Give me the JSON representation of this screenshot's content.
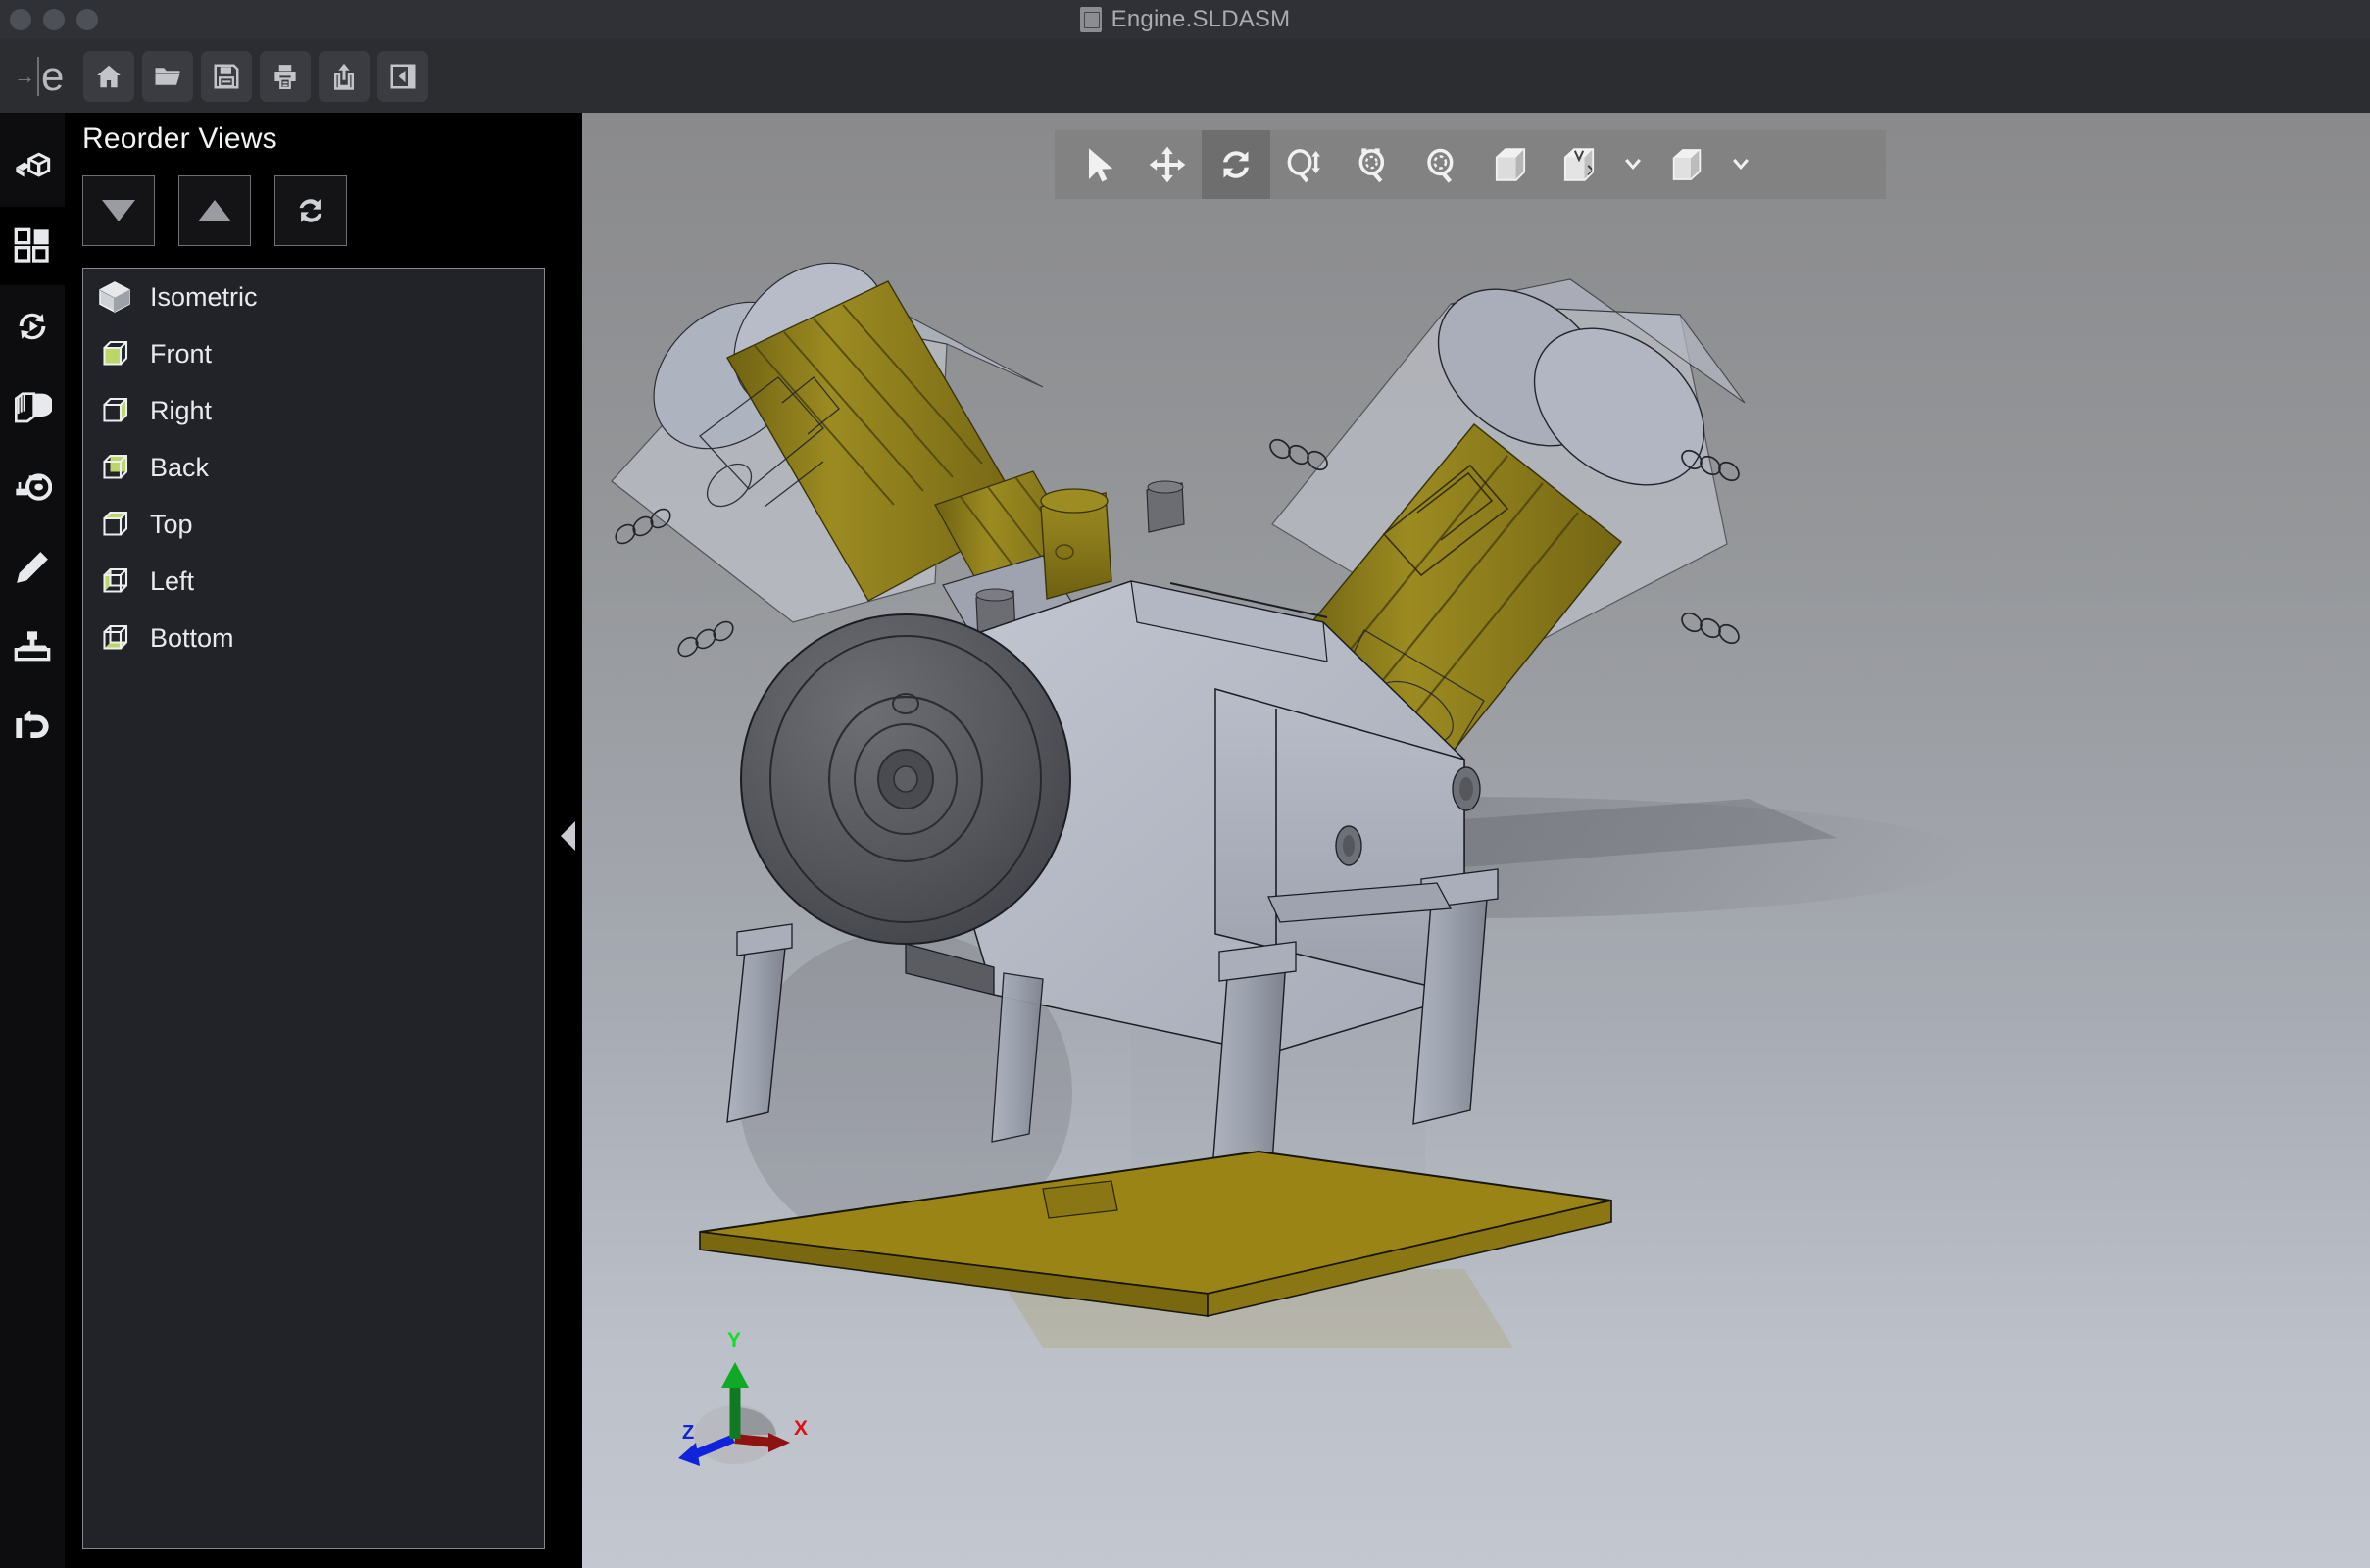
{
  "window": {
    "title": "Engine.SLDASM",
    "title_icon": "assembly-document-icon",
    "controls": [
      "close-dot",
      "minimize-dot",
      "maximize-dot"
    ]
  },
  "main_toolbar": {
    "logo_arrow": "→",
    "logo_letter": "e",
    "buttons": [
      {
        "name": "home-button",
        "icon": "home-icon",
        "label": "Home"
      },
      {
        "name": "open-button",
        "icon": "folder-open-icon",
        "label": "Open"
      },
      {
        "name": "save-button",
        "icon": "floppy-save-icon",
        "label": "Save"
      },
      {
        "name": "print-button",
        "icon": "printer-icon",
        "label": "Print"
      },
      {
        "name": "export-button",
        "icon": "share-upload-icon",
        "label": "Export"
      },
      {
        "name": "toggle-panel-button",
        "icon": "collapse-panel-icon",
        "label": "Toggle Panel"
      }
    ]
  },
  "rail": {
    "items": [
      {
        "name": "sidebar-model-tree",
        "icon": "assembly-model-icon",
        "active": false
      },
      {
        "name": "sidebar-views",
        "icon": "grid-views-icon",
        "active": true
      },
      {
        "name": "sidebar-animation",
        "icon": "animation-play-icon",
        "active": false
      },
      {
        "name": "sidebar-section",
        "icon": "section-view-icon",
        "active": false
      },
      {
        "name": "sidebar-measure",
        "icon": "measure-tape-icon",
        "active": false
      },
      {
        "name": "sidebar-markup",
        "icon": "pencil-markup-icon",
        "active": false
      },
      {
        "name": "sidebar-stamp",
        "icon": "stamp-icon",
        "active": false
      },
      {
        "name": "sidebar-history",
        "icon": "undo-history-icon",
        "active": false
      }
    ]
  },
  "panel": {
    "title": "Reorder Views",
    "actions": [
      {
        "name": "move-down-button",
        "icon": "triangle-down-icon",
        "label": "Move Down"
      },
      {
        "name": "move-up-button",
        "icon": "triangle-up-icon",
        "label": "Move Up"
      },
      {
        "name": "reset-order-button",
        "icon": "refresh-reset-icon",
        "label": "Reset"
      }
    ],
    "views": [
      {
        "label": "Isometric",
        "icon": "cube-isometric-icon",
        "highlight": "none"
      },
      {
        "label": "Front",
        "icon": "cube-front-icon",
        "highlight": "green"
      },
      {
        "label": "Right",
        "icon": "cube-right-icon",
        "highlight": "green"
      },
      {
        "label": "Back",
        "icon": "cube-back-icon",
        "highlight": "green"
      },
      {
        "label": "Top",
        "icon": "cube-top-icon",
        "highlight": "green"
      },
      {
        "label": "Left",
        "icon": "cube-left-icon",
        "highlight": "green"
      },
      {
        "label": "Bottom",
        "icon": "cube-bottom-icon",
        "highlight": "green"
      }
    ],
    "collapse_handle": "collapse-left-arrow-icon"
  },
  "viewport": {
    "toolbar": [
      {
        "name": "select-tool",
        "icon": "cursor-arrow-icon",
        "active": false
      },
      {
        "name": "pan-tool",
        "icon": "pan-move-icon",
        "active": false
      },
      {
        "name": "rotate-tool",
        "icon": "rotate-refresh-icon",
        "active": true
      },
      {
        "name": "zoom-in-out-tool",
        "icon": "zoom-updown-icon",
        "active": false
      },
      {
        "name": "zoom-to-fit-tool",
        "icon": "zoom-fit-icon",
        "active": false
      },
      {
        "name": "zoom-area-tool",
        "icon": "zoom-area-icon",
        "active": false
      },
      {
        "name": "shaded-view-tool",
        "icon": "shaded-box-icon",
        "active": false
      },
      {
        "name": "display-style-tool",
        "icon": "display-style-icon",
        "active": false
      },
      {
        "name": "display-style-chevron",
        "icon": "chevron-down-icon",
        "active": false
      },
      {
        "name": "appearance-tool",
        "icon": "appearance-box-icon",
        "active": false
      },
      {
        "name": "appearance-chevron",
        "icon": "chevron-down-icon",
        "active": false
      }
    ],
    "triad": {
      "x_label": "X",
      "x_color": "#cc1111",
      "y_label": "Y",
      "y_color": "#11bb22",
      "z_label": "Z",
      "z_color": "#1122dd"
    },
    "model": {
      "name": "v-twin-engine-assembly",
      "colors": {
        "body_gray": "#b6bac6",
        "cylinder_gold": "#8c7c1c",
        "flywheel_dark": "#57585c",
        "base_plate_gold": "#9a8415",
        "edge_line": "#12131a",
        "translucent_plate": "#c7cad3"
      }
    }
  }
}
